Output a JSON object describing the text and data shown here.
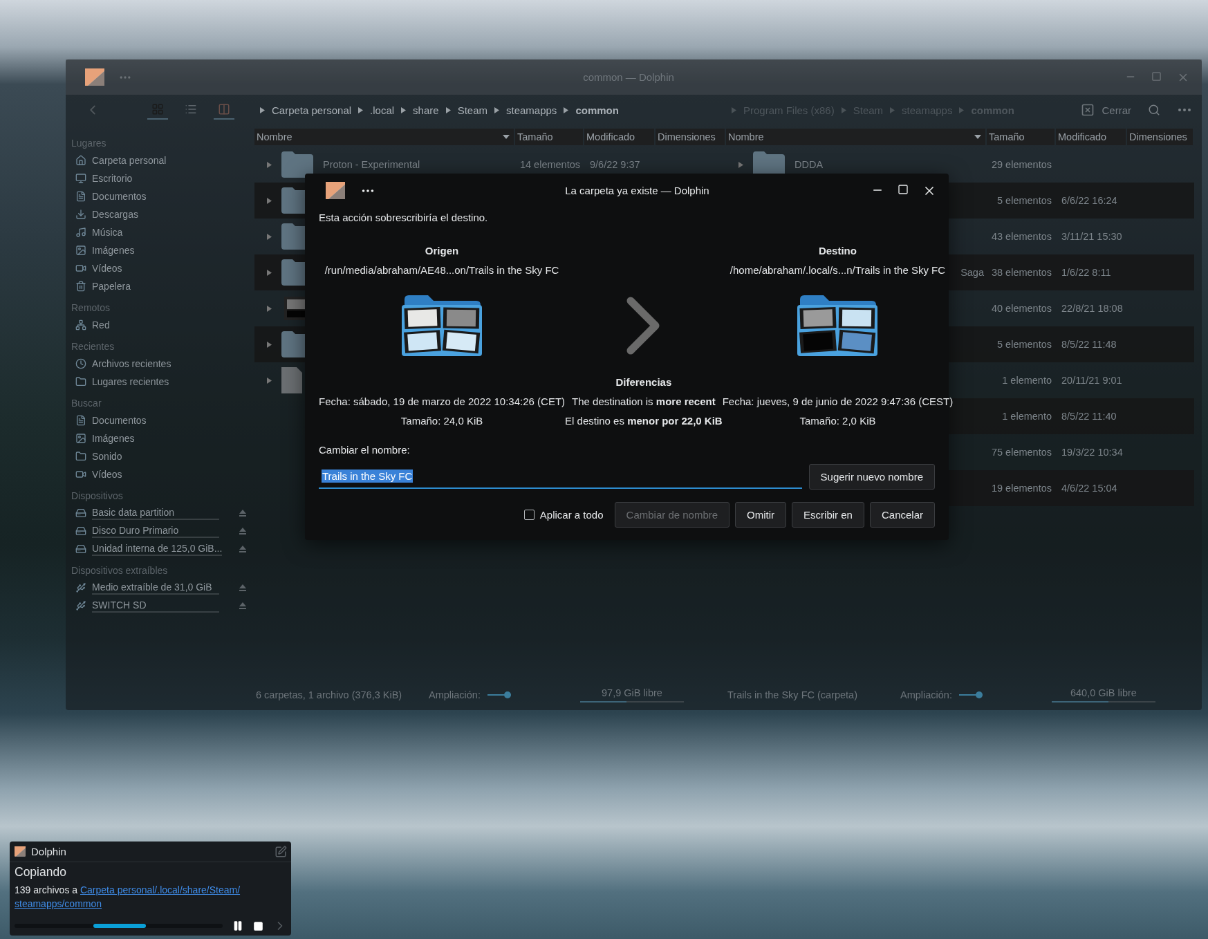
{
  "window": {
    "title": "common — Dolphin"
  },
  "toolbar": {
    "view_modes": [
      {
        "kind": "icons",
        "selected": true
      },
      {
        "kind": "details",
        "selected": false
      }
    ],
    "split": {
      "checked": true
    },
    "close_label": "Cerrar"
  },
  "sidebar": {
    "sections": [
      {
        "title": "Lugares",
        "items": [
          {
            "label": "Carpeta personal",
            "kind": "home"
          },
          {
            "label": "Escritorio",
            "kind": "desktop"
          },
          {
            "label": "Documentos",
            "kind": "documents"
          },
          {
            "label": "Descargas",
            "kind": "downloads"
          },
          {
            "label": "Música",
            "kind": "music"
          },
          {
            "label": "Imágenes",
            "kind": "pictures"
          },
          {
            "label": "Vídeos",
            "kind": "videos"
          },
          {
            "label": "Papelera",
            "kind": "trash"
          }
        ]
      },
      {
        "title": "Remotos",
        "items": [
          {
            "label": "Red",
            "kind": "network"
          }
        ]
      },
      {
        "title": "Recientes",
        "items": [
          {
            "label": "Archivos recientes",
            "kind": "recent"
          },
          {
            "label": "Lugares recientes",
            "kind": "folder"
          }
        ]
      },
      {
        "title": "Buscar",
        "items": [
          {
            "label": "Documentos",
            "kind": "documents"
          },
          {
            "label": "Imágenes",
            "kind": "pictures"
          },
          {
            "label": "Sonido",
            "kind": "folder"
          },
          {
            "label": "Vídeos",
            "kind": "videos"
          }
        ]
      },
      {
        "title": "Dispositivos",
        "items": [
          {
            "label": "Basic data partition",
            "kind": "drive",
            "eject": true
          },
          {
            "label": "Disco Duro Primario",
            "kind": "drive",
            "eject": true
          },
          {
            "label": "Unidad interna de 125,0 GiB...",
            "kind": "drive",
            "eject": true
          }
        ]
      },
      {
        "title": "Dispositivos extraíbles",
        "items": [
          {
            "label": "Medio extraíble de 31,0 GiB",
            "kind": "usb",
            "eject": true
          },
          {
            "label": "SWITCH SD",
            "kind": "usb",
            "eject": true
          }
        ]
      }
    ]
  },
  "panes": [
    {
      "active": true,
      "breadcrumb": [
        {
          "label": "Carpeta personal",
          "current": false
        },
        {
          "label": ".local",
          "current": false
        },
        {
          "label": "share",
          "current": false
        },
        {
          "label": "Steam",
          "current": false
        },
        {
          "label": "steamapps",
          "current": false
        },
        {
          "label": "common",
          "current": true
        }
      ],
      "columns": [
        "Nombre",
        "Tamaño",
        "Modificado",
        "Dimensiones"
      ],
      "rows": [
        {
          "kind": "folder",
          "name": "Proton - Experimental",
          "size": "14 elementos",
          "modified": "9/6/22 9:37"
        },
        {
          "kind": "folder"
        },
        {
          "kind": "folder"
        },
        {
          "kind": "folder"
        },
        {
          "kind": "video"
        },
        {
          "kind": "folder"
        },
        {
          "kind": "file"
        }
      ],
      "status": {
        "summary": "6 carpetas, 1 archivo (376,3 KiB)",
        "zoom_label": "Ampliación:",
        "zoom": {
          "level": 0.85
        },
        "free_space": {
          "label": "97,9 GiB libre",
          "level": 0.45
        }
      }
    },
    {
      "active": false,
      "breadcrumb": [
        {
          "label": "Program Files (x86)",
          "current": false
        },
        {
          "label": "Steam",
          "current": false
        },
        {
          "label": "steamapps",
          "current": false
        },
        {
          "label": "common",
          "current": true
        }
      ],
      "columns": [
        "Nombre",
        "Tamaño",
        "Modificado",
        "Dimensiones"
      ],
      "rows": [
        {
          "kind": "folder",
          "name": "DDDA",
          "size": "29 elementos"
        },
        {
          "kind": "folder",
          "size": "5 elementos",
          "modified": "6/6/22 16:24"
        },
        {
          "kind": "folder",
          "size": "43 elementos",
          "modified": "3/11/21 15:30"
        },
        {
          "kind": "folder",
          "name": "Saga",
          "clipped": true,
          "size": "38 elementos",
          "modified": "1/6/22 8:11"
        },
        {
          "kind": "folder",
          "size": "40 elementos",
          "modified": "22/8/21 18:08"
        },
        {
          "kind": "folder",
          "size": "5 elementos",
          "modified": "8/5/22 11:48"
        },
        {
          "kind": "folder",
          "size": "1 elemento",
          "modified": "20/11/21 9:01"
        },
        {
          "kind": "folder",
          "size": "1 elemento",
          "modified": "8/5/22 11:40"
        },
        {
          "kind": "folder",
          "size": "75 elementos",
          "modified": "19/3/22 10:34"
        },
        {
          "kind": "folder",
          "size": "19 elementos",
          "modified": "4/6/22 15:04"
        }
      ],
      "status": {
        "summary": "Trails in the Sky FC (carpeta)",
        "zoom_label": "Ampliación:",
        "zoom": {
          "level": 0.85
        },
        "free_space": {
          "label": "640,0 GiB libre",
          "level": 0.55
        }
      }
    }
  ],
  "dialog": {
    "title": "La carpeta ya existe — Dolphin",
    "message": "Esta acción sobrescribiría el destino.",
    "source": {
      "heading": "Origen",
      "path": "/run/media/abraham/AE48...on/Trails in the Sky FC",
      "date": "Fecha: sábado, 19 de marzo de 2022 10:34:26 (CET)",
      "size": "Tamaño: 24,0 KiB"
    },
    "destination": {
      "heading": "Destino",
      "path": "/home/abraham/.local/s...n/Trails in the Sky FC",
      "date": "Fecha: jueves, 9 de junio de 2022 9:47:36 (CEST)",
      "size": "Tamaño: 2,0 KiB"
    },
    "differences": {
      "heading": "Diferencias",
      "lines": [
        "The destination is **more recent**",
        "El destino es **menor por 22,0 KiB**"
      ]
    },
    "rename": {
      "label": "Cambiar el nombre:",
      "value": "Trails in the Sky FC",
      "text_selected": true,
      "suggest_button": "Sugerir nuevo nombre"
    },
    "apply_all": {
      "label": "Aplicar a todo",
      "checked": false
    },
    "buttons": [
      {
        "label": "Cambiar de nombre",
        "disabled": true
      },
      {
        "label": "Omitir",
        "disabled": false
      },
      {
        "label": "Escribir en",
        "disabled": false
      },
      {
        "label": "Cancelar",
        "disabled": false
      }
    ]
  },
  "notification": {
    "app": "Dolphin",
    "title": "Copiando",
    "text": "139 archivos a",
    "link_lines": [
      "Carpeta personal/.local/share/Steam/",
      "steamapps/common"
    ]
  }
}
